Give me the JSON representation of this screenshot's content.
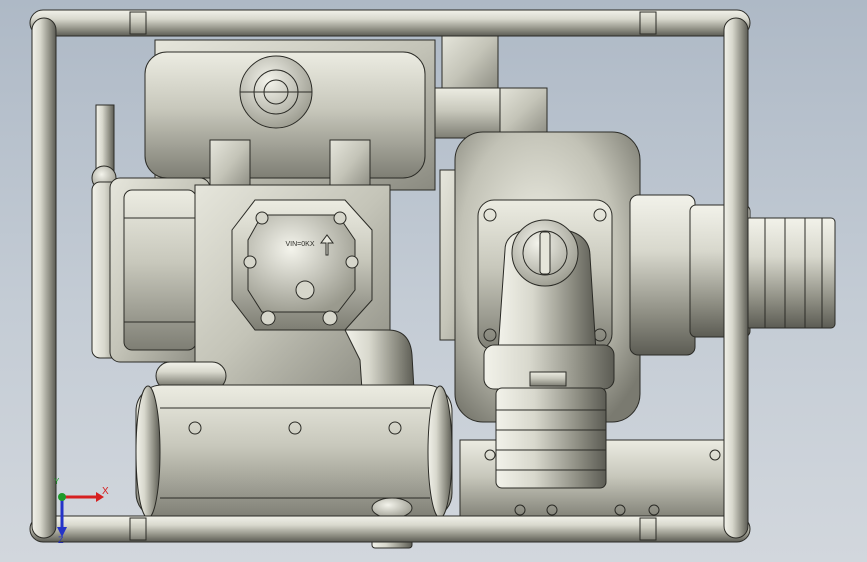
{
  "viewport": {
    "background_top": "#aeb9c6",
    "background_bottom": "#d2d7dd",
    "model_color": "#c9c9bd",
    "edge_color": "#2b2b26"
  },
  "engine": {
    "decal_text": "VIN=0KX"
  },
  "triad": {
    "x_label": "X",
    "y_label": "Y",
    "z_label": "Z",
    "x_color": "#d62020",
    "y_color": "#1f9a2a",
    "z_color": "#2433c8"
  }
}
